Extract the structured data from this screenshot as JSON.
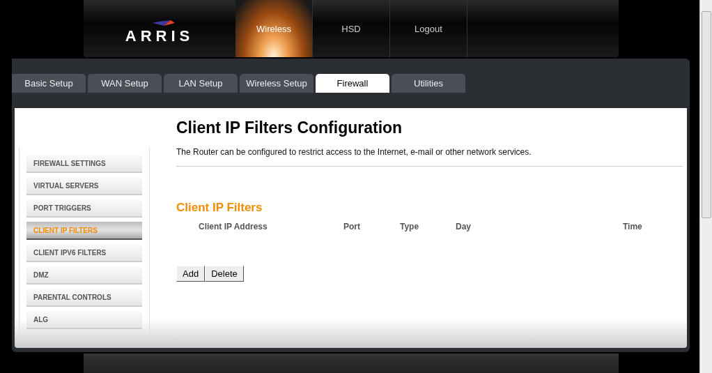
{
  "header": {
    "logo": "ARRIS",
    "nav": [
      {
        "label": "Wireless",
        "selected": true
      },
      {
        "label": "HSD",
        "selected": false
      },
      {
        "label": "Logout",
        "selected": false
      }
    ]
  },
  "tabs": [
    {
      "label": "Basic Setup",
      "selected": false
    },
    {
      "label": "WAN Setup",
      "selected": false
    },
    {
      "label": "LAN Setup",
      "selected": false
    },
    {
      "label": "Wireless Setup",
      "selected": false
    },
    {
      "label": "Firewall",
      "selected": true
    },
    {
      "label": "Utilities",
      "selected": false
    }
  ],
  "sidebar": {
    "items": [
      {
        "label": "FIREWALL SETTINGS",
        "selected": false
      },
      {
        "label": "VIRTUAL SERVERS",
        "selected": false
      },
      {
        "label": "PORT TRIGGERS",
        "selected": false
      },
      {
        "label": "CLIENT IP FILTERS",
        "selected": true
      },
      {
        "label": "CLIENT IPV6 FILTERS",
        "selected": false
      },
      {
        "label": "DMZ",
        "selected": false
      },
      {
        "label": "PARENTAL CONTROLS",
        "selected": false
      },
      {
        "label": "ALG",
        "selected": false
      }
    ]
  },
  "content": {
    "title": "Client IP Filters Configuration",
    "description": "The Router can be configured to restrict access to the Internet, e-mail or other network services.",
    "section": "Client IP Filters",
    "table": {
      "columns": [
        "Client IP Address",
        "Port",
        "Type",
        "Day",
        "Time"
      ]
    },
    "buttons": [
      "Add",
      "Delete"
    ]
  }
}
